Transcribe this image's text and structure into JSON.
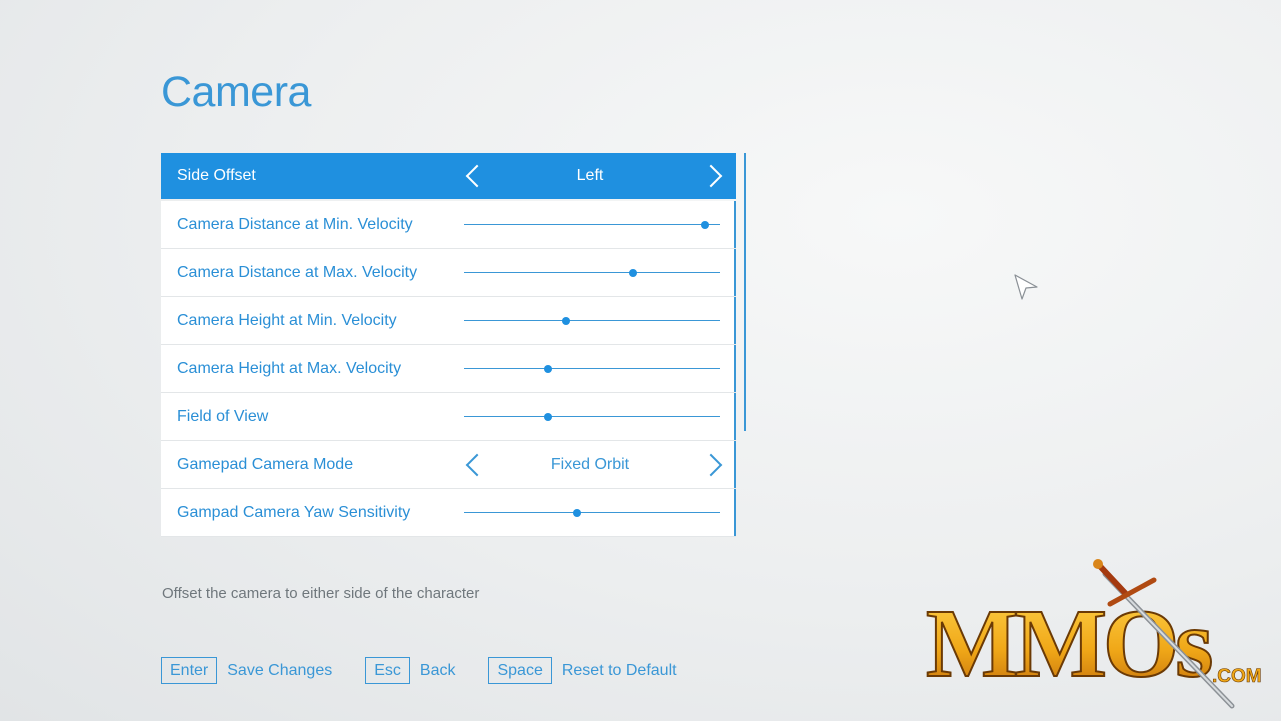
{
  "page": {
    "title": "Camera",
    "description": "Offset the camera to either side of the character"
  },
  "settings": {
    "side_offset": {
      "label": "Side Offset",
      "value": "Left"
    },
    "cam_dist_min": {
      "label": "Camera Distance at Min. Velocity",
      "level": 0.94
    },
    "cam_dist_max": {
      "label": "Camera Distance at Max. Velocity",
      "level": 0.66
    },
    "cam_height_min": {
      "label": "Camera Height at Min. Velocity",
      "level": 0.4
    },
    "cam_height_max": {
      "label": "Camera Height at Max. Velocity",
      "level": 0.33
    },
    "fov": {
      "label": "Field of View",
      "level": 0.33
    },
    "gamepad_mode": {
      "label": "Gamepad Camera Mode",
      "value": "Fixed Orbit"
    },
    "yaw_sens": {
      "label": "Gampad Camera Yaw Sensitivity",
      "level": 0.44
    }
  },
  "footer": {
    "enter_key": "Enter",
    "enter_label": "Save Changes",
    "esc_key": "Esc",
    "esc_label": "Back",
    "space_key": "Space",
    "space_label": "Reset to Default"
  },
  "logo": {
    "main": "MMOs",
    "suffix": ".COM"
  },
  "colors": {
    "accent": "#1f90e0",
    "text": "#2a8fd6",
    "description": "#6f777c",
    "logo_gold": "#f0a818"
  },
  "icons": {
    "arrow_left": "chevron-left-icon",
    "arrow_right": "chevron-right-icon",
    "cursor": "mouse-cursor-icon",
    "sword": "sword-icon"
  }
}
